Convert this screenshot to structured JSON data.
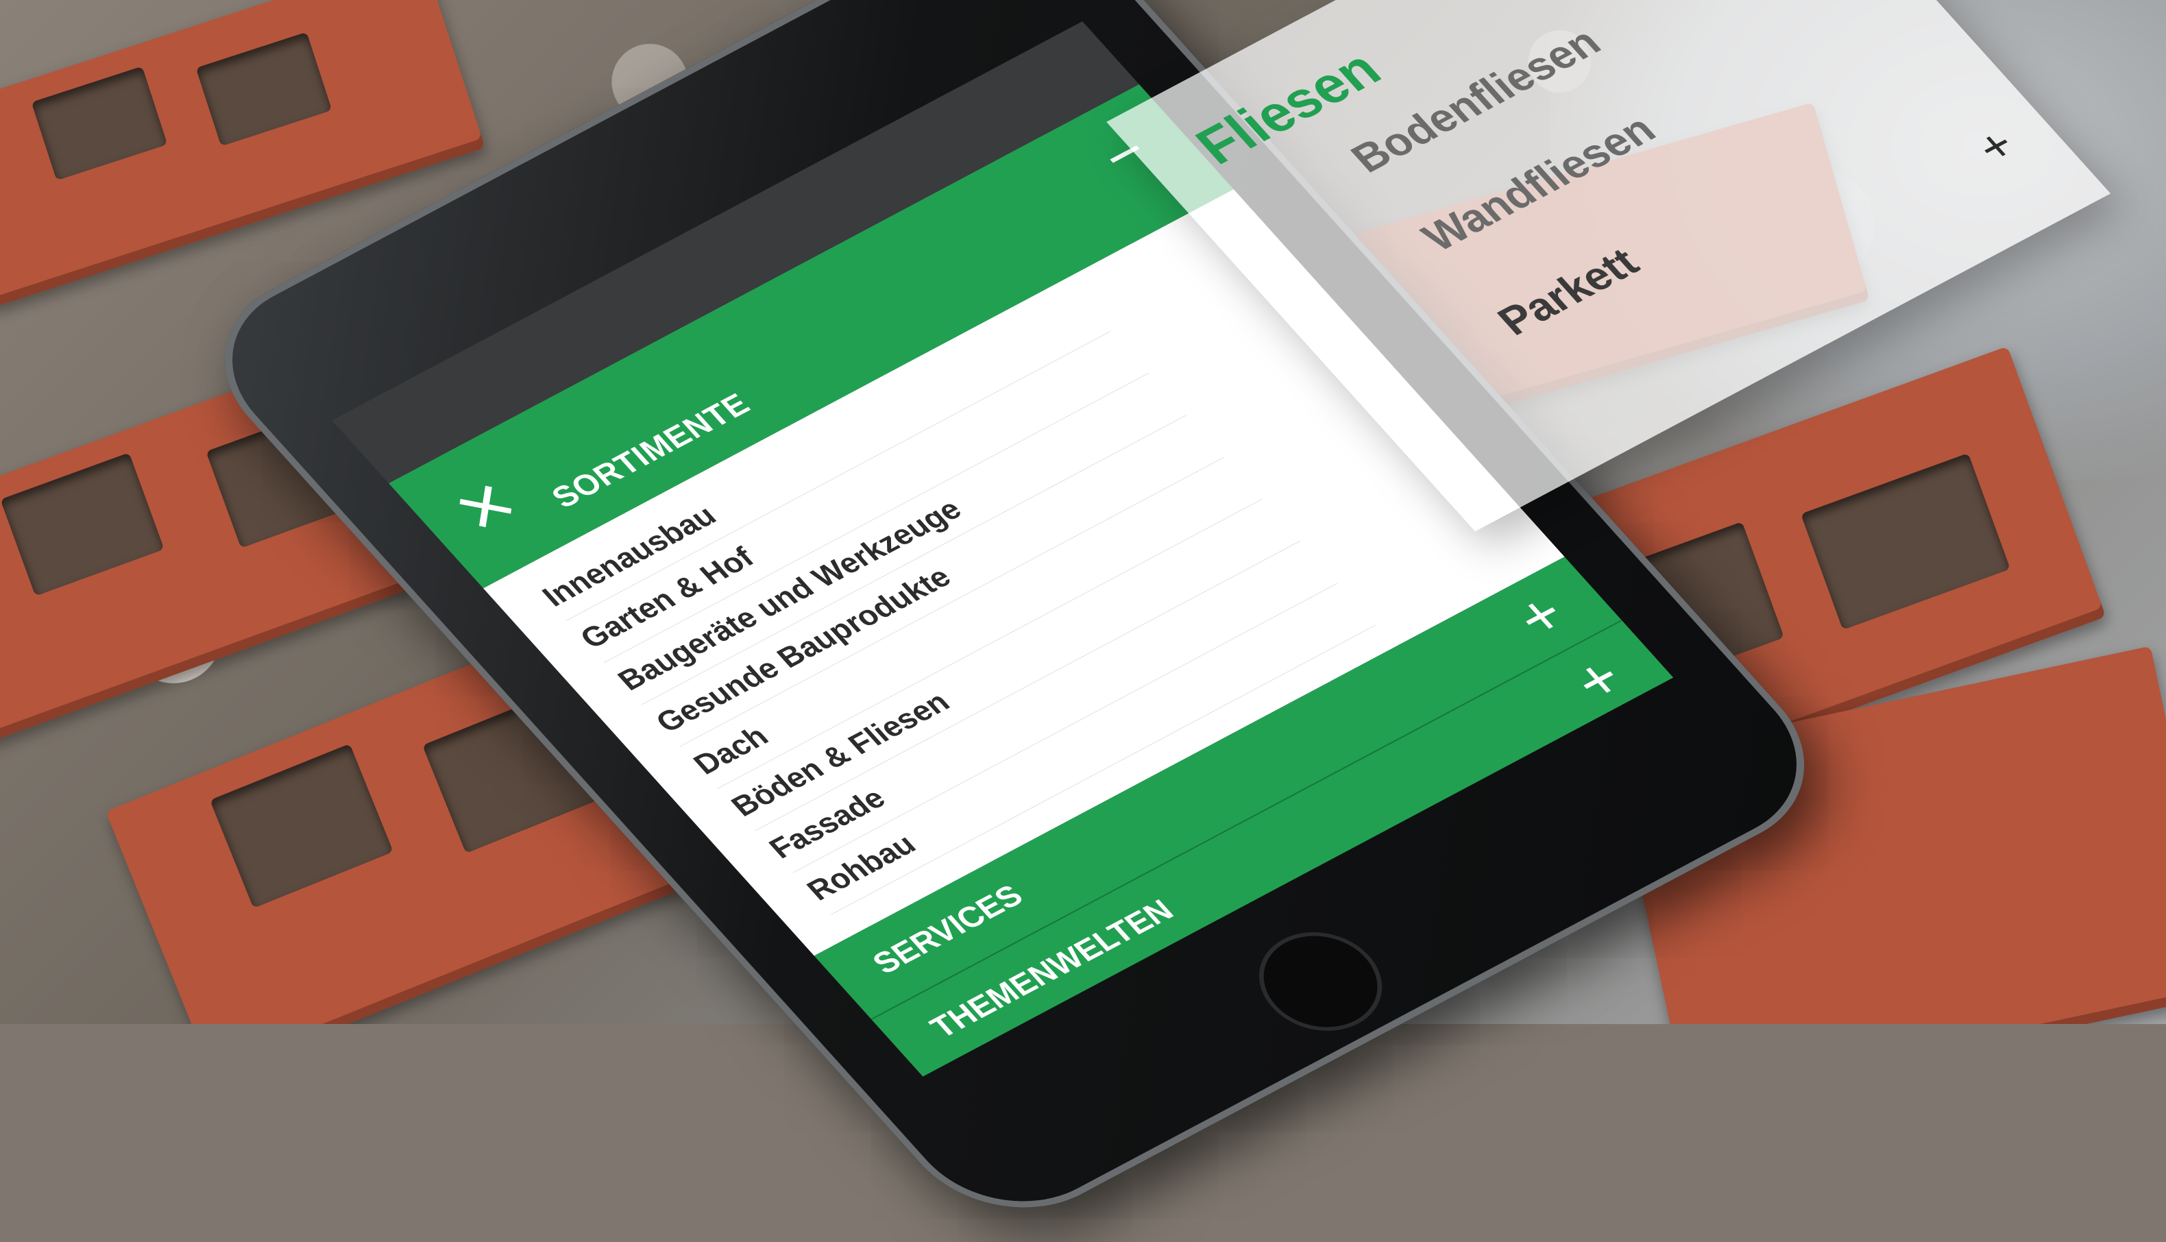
{
  "menu": {
    "close_icon": "×",
    "section_title": "SORTIMENTE",
    "header_icon": "−",
    "items": [
      {
        "label": "Innenausbau"
      },
      {
        "label": "Garten & Hof"
      },
      {
        "label": "Baugeräte und Werkzeuge"
      },
      {
        "label": "Gesunde Bauprodukte"
      },
      {
        "label": "Dach"
      },
      {
        "label": "Böden & Fliesen"
      },
      {
        "label": "Fassade"
      },
      {
        "label": "Rohbau"
      }
    ],
    "services": {
      "label": "SERVICES",
      "icon": "+"
    },
    "themenwelten": {
      "label": "THEMENWELTEN",
      "icon": "+"
    }
  },
  "submenu": {
    "title": "Fliesen",
    "items": [
      {
        "label": "Bodenfliesen"
      },
      {
        "label": "Wandfliesen"
      },
      {
        "label": "Parkett"
      }
    ],
    "plus_icon": "+",
    "minus_icon": "−"
  },
  "colors": {
    "brand_green": "#21a052",
    "brick": "#b5553c"
  }
}
